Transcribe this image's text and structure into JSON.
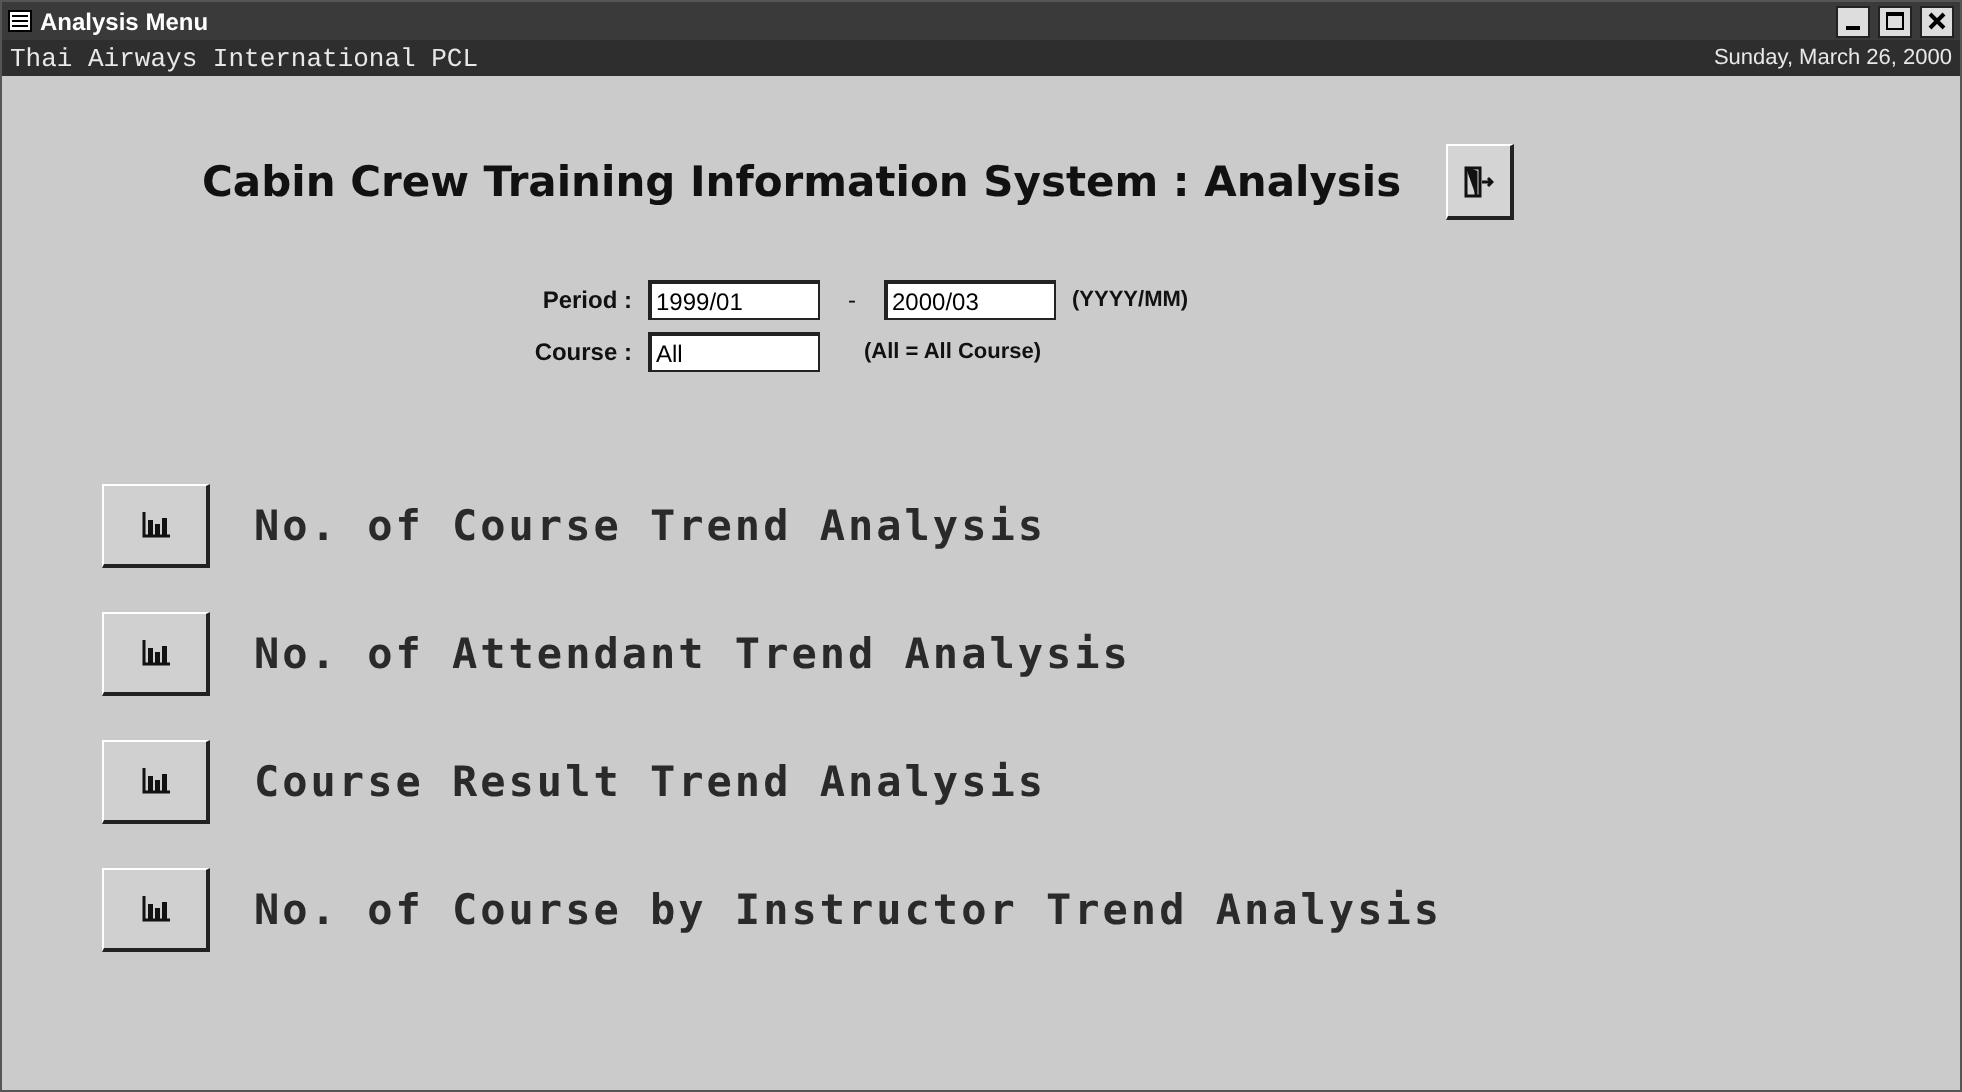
{
  "window": {
    "title": "Analysis Menu"
  },
  "header": {
    "company": "Thai Airways International PCL",
    "date": "Sunday, March 26, 2000"
  },
  "form": {
    "heading": "Cabin Crew Training Information System : Analysis",
    "period": {
      "label": "Period :",
      "from": "1999/01",
      "separator": "-",
      "to": "2000/03",
      "hint": "(YYYY/MM)"
    },
    "course": {
      "label": "Course :",
      "value": "All",
      "hint": "(All = All Course)"
    }
  },
  "menu": [
    {
      "label": "No. of Course Trend Analysis"
    },
    {
      "label": "No. of Attendant Trend Analysis"
    },
    {
      "label": "Course Result Trend Analysis"
    },
    {
      "label": "No. of Course by Instructor Trend Analysis"
    }
  ]
}
